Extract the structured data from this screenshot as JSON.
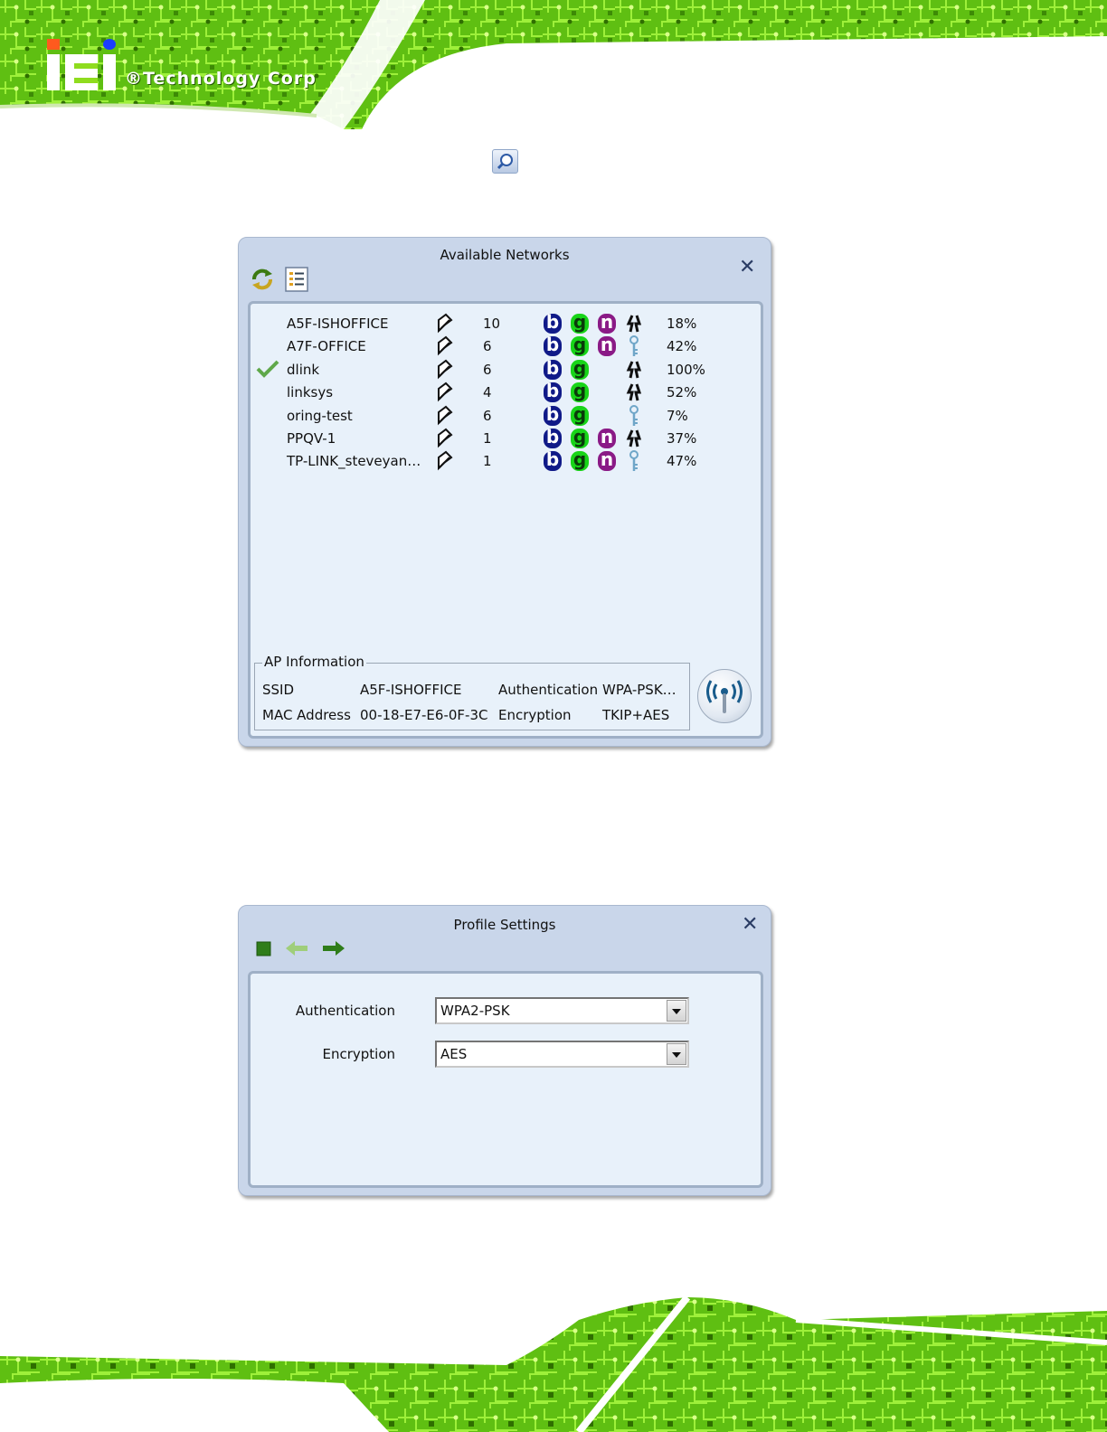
{
  "brand": {
    "tagline": "®Technology Corp"
  },
  "colors": {
    "circuit_green": "#7ed321",
    "dialog_frame": "#c9d6ea",
    "dialog_body": "#e8f1fa",
    "badge_b": "#101a88",
    "badge_g": "#18d418",
    "badge_n": "#8a1a86"
  },
  "toolbar_icon": "magnifier-icon",
  "available_networks": {
    "title": "Available Networks",
    "close": "✕",
    "toolbar": [
      "refresh-icon",
      "list-view-icon"
    ],
    "networks": [
      {
        "ssid": "A5F-ISHOFFICE",
        "channel": "10",
        "b": "b",
        "g": "g",
        "n": "n",
        "security": "wpa-icon",
        "signal": "18%",
        "connected": false
      },
      {
        "ssid": "A7F-OFFICE",
        "channel": "6",
        "b": "b",
        "g": "g",
        "n": "n",
        "security": "key-icon",
        "signal": "42%",
        "connected": false
      },
      {
        "ssid": "dlink",
        "channel": "6",
        "b": "b",
        "g": "g",
        "n": "",
        "security": "wpa-icon",
        "signal": "100%",
        "connected": true
      },
      {
        "ssid": "linksys",
        "channel": "4",
        "b": "b",
        "g": "g",
        "n": "",
        "security": "wpa-icon",
        "signal": "52%",
        "connected": false
      },
      {
        "ssid": "oring-test",
        "channel": "6",
        "b": "b",
        "g": "g",
        "n": "",
        "security": "key-icon",
        "signal": "7%",
        "connected": false
      },
      {
        "ssid": "PPQV-1",
        "channel": "1",
        "b": "b",
        "g": "g",
        "n": "n",
        "security": "wpa-icon",
        "signal": "37%",
        "connected": false
      },
      {
        "ssid": "TP-LINK_steveyan…",
        "channel": "1",
        "b": "b",
        "g": "g",
        "n": "n",
        "security": "key-icon",
        "signal": "47%",
        "connected": false
      }
    ],
    "ap_info": {
      "legend": "AP Information",
      "ssid_label": "SSID",
      "ssid_value": "A5F-ISHOFFICE",
      "mac_label": "MAC Address",
      "mac_value": "00-18-E7-E6-0F-3C",
      "auth_label": "Authentication",
      "auth_value": "WPA-PSK…",
      "enc_label": "Encryption",
      "enc_value": "TKIP+AES"
    }
  },
  "profile_settings": {
    "title": "Profile Settings",
    "close": "✕",
    "toolbar": [
      "stop-icon",
      "back-arrow-icon",
      "forward-arrow-icon"
    ],
    "authentication_label": "Authentication",
    "authentication_value": "WPA2-PSK",
    "encryption_label": "Encryption",
    "encryption_value": "AES"
  }
}
